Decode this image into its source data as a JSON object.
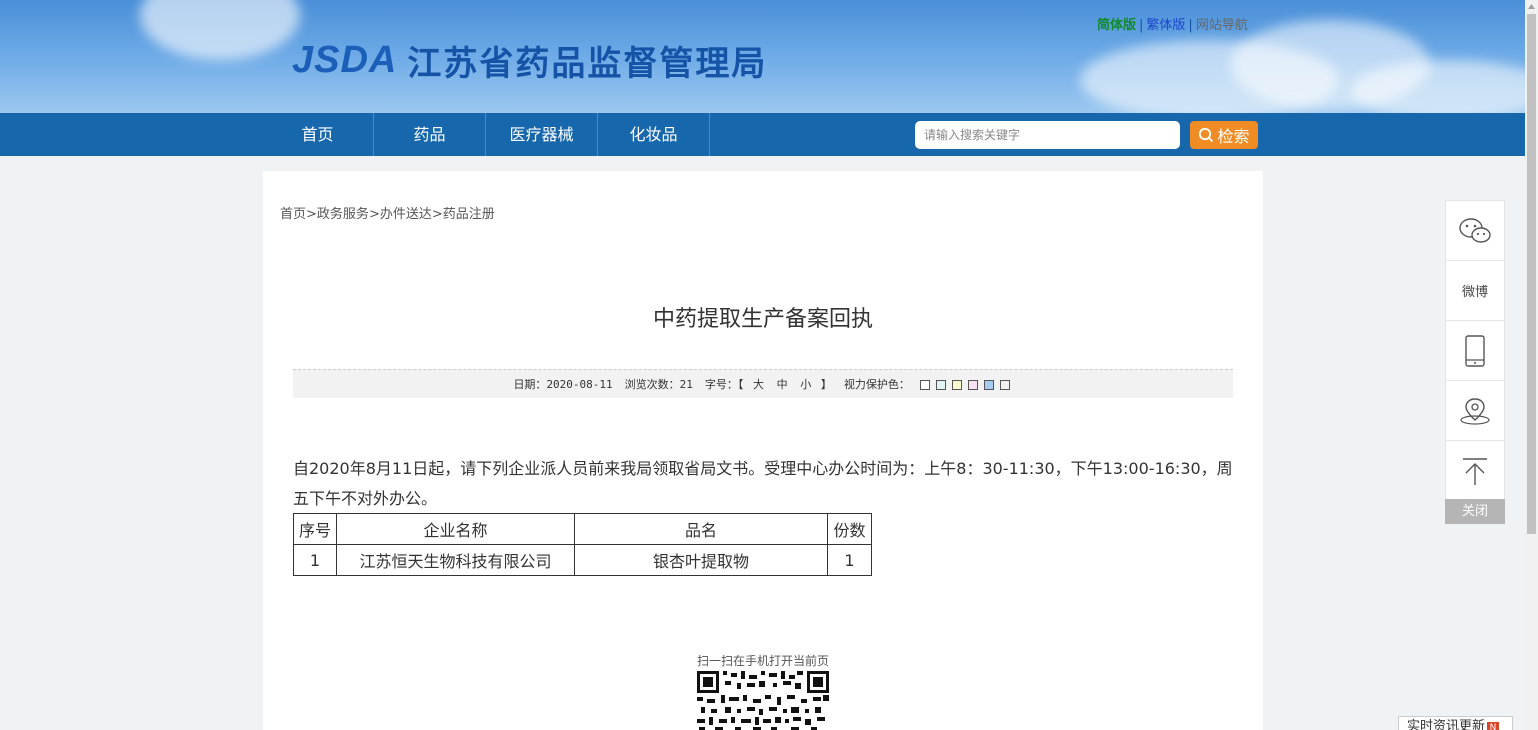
{
  "header": {
    "logo_en": "JSDA",
    "logo_cn": "江苏省药品监督管理局",
    "lang_simplified": "简体版",
    "lang_traditional": "繁体版",
    "site_nav": "网站导航",
    "separator": "|"
  },
  "nav": {
    "items": [
      "首页",
      "药品",
      "医疗器械",
      "化妆品"
    ]
  },
  "search": {
    "placeholder": "请输入搜索关键字",
    "button_label": "检索"
  },
  "breadcrumb": {
    "items": [
      "首页",
      "政务服务",
      "办件送达",
      "药品注册"
    ],
    "separator": ">"
  },
  "article": {
    "title": "中药提取生产备案回执",
    "date_label": "日期：",
    "date_value": "2020-08-11",
    "views_label": "浏览次数：",
    "views_value": "21",
    "font_label": "字号：【",
    "font_large": "大",
    "font_medium": "中",
    "font_small": "小",
    "font_close": "】",
    "eye_label": "视力保护色：",
    "eye_colors": [
      "#ffffff",
      "#e0f4f4",
      "#fcf8d0",
      "#fbe0f4",
      "#a6cbef",
      "#f0f0f0"
    ],
    "paragraph": "自2020年8月11日起，请下列企业派人员前来我局领取省局文书。受理中心办公时间为：上午8：30-11:30，下午13:00-16:30，周五下午不对外办公。",
    "table": {
      "headers": [
        "序号",
        "企业名称",
        "品名",
        "份数"
      ],
      "rows": [
        [
          "1",
          "江苏恒天生物科技有限公司",
          "银杏叶提取物",
          "1"
        ]
      ]
    },
    "qr_label": "扫一扫在手机打开当前页"
  },
  "float_panel": {
    "weibo": "微博",
    "close": "关闭"
  },
  "realtime": {
    "label": "实时资讯更新",
    "badge": "N"
  }
}
